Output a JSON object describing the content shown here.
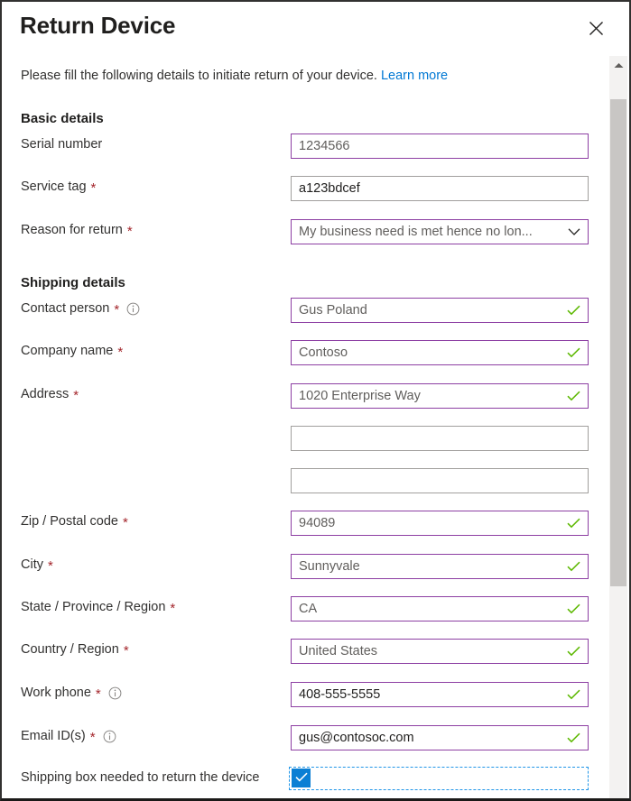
{
  "dialog": {
    "title": "Return Device",
    "close_icon": "close-icon",
    "intro_text": "Please fill the following details to initiate return of your device.",
    "learn_more_label": "Learn more"
  },
  "sections": {
    "basic": {
      "title": "Basic details"
    },
    "shipping": {
      "title": "Shipping details"
    }
  },
  "fields": {
    "serial_number": {
      "label": "Serial number",
      "required": false,
      "has_info": false,
      "value": "1234566",
      "border": "accent",
      "valid": false
    },
    "service_tag": {
      "label": "Service tag",
      "required": true,
      "has_info": false,
      "value": "a123bdcef",
      "border": "default",
      "valid": false
    },
    "reason_for_return": {
      "label": "Reason for return",
      "required": true,
      "has_info": false,
      "value": "My business need is met hence no lon...",
      "border": "accent",
      "type": "dropdown"
    },
    "contact_person": {
      "label": "Contact person",
      "required": true,
      "has_info": true,
      "value": "Gus Poland",
      "border": "accent",
      "valid": true
    },
    "company_name": {
      "label": "Company name",
      "required": true,
      "has_info": false,
      "value": "Contoso",
      "border": "accent",
      "valid": true
    },
    "address_line1": {
      "label": "Address",
      "required": true,
      "has_info": false,
      "value": "1020 Enterprise Way",
      "border": "accent",
      "valid": true
    },
    "address_line2": {
      "label": "",
      "value": "",
      "border": "default",
      "valid": false
    },
    "address_line3": {
      "label": "",
      "value": "",
      "border": "default",
      "valid": false
    },
    "zip_postal_code": {
      "label": "Zip / Postal code",
      "required": true,
      "has_info": false,
      "value": "94089",
      "border": "accent",
      "valid": true
    },
    "city": {
      "label": "City",
      "required": true,
      "has_info": false,
      "value": "Sunnyvale",
      "border": "accent",
      "valid": true
    },
    "state_province_region": {
      "label": "State / Province / Region",
      "required": true,
      "has_info": false,
      "value": "CA",
      "border": "accent",
      "valid": true
    },
    "country_region": {
      "label": "Country / Region",
      "required": true,
      "has_info": false,
      "value": "United States",
      "border": "accent",
      "valid": true
    },
    "work_phone": {
      "label": "Work phone",
      "required": true,
      "has_info": true,
      "value": "408-555-5555",
      "border": "accent",
      "valid": true
    },
    "email_ids": {
      "label": "Email ID(s)",
      "required": true,
      "has_info": true,
      "value": "gus@contosoc.com",
      "border": "accent",
      "valid": true
    }
  },
  "checkbox": {
    "label": "Shipping box needed to return the device",
    "checked": true
  },
  "required_marker": "*",
  "colors": {
    "accent_border": "#8d3fa3",
    "default_border": "#a19f9d",
    "required_asterisk": "#a4262c",
    "valid_check": "#5cb800",
    "link": "#0078d4",
    "checkbox_fill": "#0b7fd4",
    "focus_outline": "#2196e8",
    "scrollbar_thumb": "#c8c6c4",
    "scrollbar_track": "#f3f2f1"
  },
  "scrollbar": {
    "up_arrow_icon": "chevron-up-icon"
  }
}
